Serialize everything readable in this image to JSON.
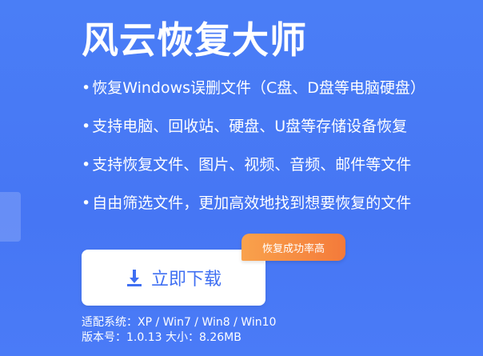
{
  "hero": {
    "title": "风云恢复大师"
  },
  "features": [
    {
      "bullet": "•",
      "text": "恢复Windows误删文件（C盘、D盘等电脑硬盘）"
    },
    {
      "bullet": "•",
      "text": "支持电脑、回收站、硬盘、U盘等存储设备恢复"
    },
    {
      "bullet": "•",
      "text": "支持恢复文件、图片、视频、音频、邮件等文件"
    },
    {
      "bullet": "•",
      "text": "自由筛选文件，更加高效地找到想要恢复的文件"
    }
  ],
  "download": {
    "label": "立即下载",
    "icon": "download-icon",
    "badge": "恢复成功率高"
  },
  "info": {
    "systems_label": "适配系统：",
    "systems_value": "XP / Win7 / Win8 / Win10",
    "version_label": "版本号：",
    "version_value": "1.0.13",
    "size_label": "大小：",
    "size_value": "8.26MB"
  },
  "colors": {
    "background": "#4a7ef6",
    "button_text": "#3f6ff2",
    "badge_start": "#f9a24c",
    "badge_end": "#f47a3a"
  }
}
